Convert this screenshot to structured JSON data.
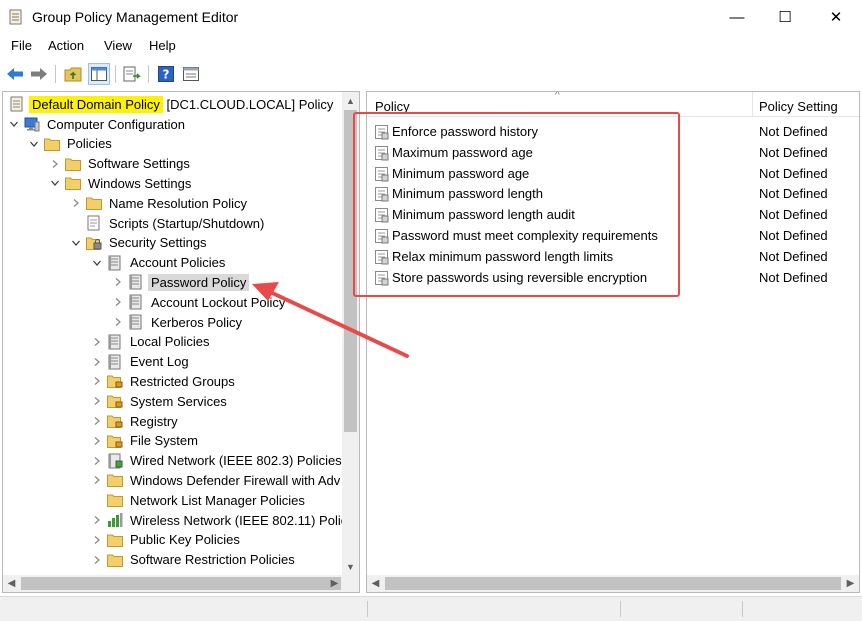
{
  "window": {
    "title": "Group Policy Management Editor",
    "minimize_glyph": "—",
    "maximize_glyph": "☐",
    "close_glyph": "✕"
  },
  "menu": {
    "file": "File",
    "action": "Action",
    "view": "View",
    "help": "Help"
  },
  "toolbar": {
    "icons": [
      "back-arrow-icon",
      "forward-arrow-icon",
      "up-folder-icon",
      "show-hide-tree-icon",
      "export-list-icon",
      "help-icon",
      "properties-icon"
    ]
  },
  "tree": {
    "root": "Default Domain Policy",
    "root_suffix": " [DC1.CLOUD.LOCAL] Policy",
    "items": [
      {
        "label": "Computer Configuration"
      },
      {
        "label": "Policies"
      },
      {
        "label": "Software Settings"
      },
      {
        "label": "Windows Settings"
      },
      {
        "label": "Name Resolution Policy"
      },
      {
        "label": "Scripts (Startup/Shutdown)"
      },
      {
        "label": "Security Settings"
      },
      {
        "label": "Account Policies"
      },
      {
        "label": "Password Policy"
      },
      {
        "label": "Account Lockout Policy"
      },
      {
        "label": "Kerberos Policy"
      },
      {
        "label": "Local Policies"
      },
      {
        "label": "Event Log"
      },
      {
        "label": "Restricted Groups"
      },
      {
        "label": "System Services"
      },
      {
        "label": "Registry"
      },
      {
        "label": "File System"
      },
      {
        "label": "Wired Network (IEEE 802.3) Policies"
      },
      {
        "label": "Windows Defender Firewall with Adv"
      },
      {
        "label": "Network List Manager Policies"
      },
      {
        "label": "Wireless Network (IEEE 802.11) Polici"
      },
      {
        "label": "Public Key Policies"
      },
      {
        "label": "Software Restriction Policies"
      }
    ]
  },
  "list": {
    "columns": {
      "policy": "Policy",
      "setting": "Policy Setting"
    },
    "rows": [
      {
        "name": "Enforce password history",
        "value": "Not Defined"
      },
      {
        "name": "Maximum password age",
        "value": "Not Defined"
      },
      {
        "name": "Minimum password age",
        "value": "Not Defined"
      },
      {
        "name": "Minimum password length",
        "value": "Not Defined"
      },
      {
        "name": "Minimum password length audit",
        "value": "Not Defined"
      },
      {
        "name": "Password must meet complexity requirements",
        "value": "Not Defined"
      },
      {
        "name": "Relax minimum password length limits",
        "value": "Not Defined"
      },
      {
        "name": "Store passwords using reversible encryption",
        "value": "Not Defined"
      }
    ]
  },
  "colors": {
    "root_highlight": "#fff200",
    "selection": "#d9d9d9",
    "annotation_red": "#e84a4a"
  }
}
